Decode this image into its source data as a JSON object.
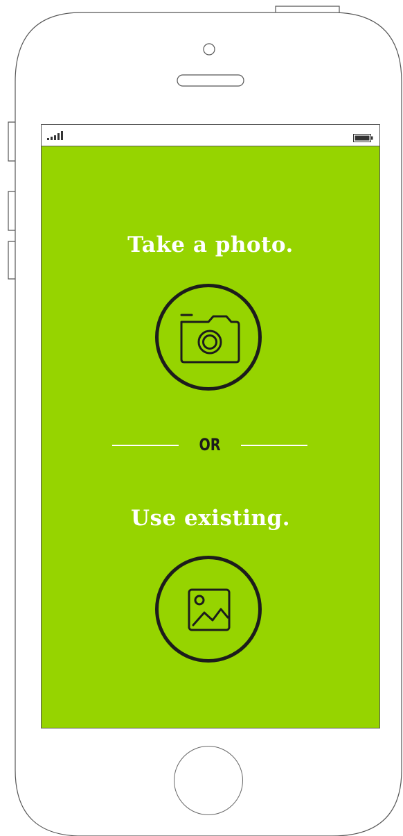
{
  "status_bar": {
    "signal_icon": "signal-bars-icon",
    "battery_icon": "battery-icon"
  },
  "screen": {
    "background_color": "#96d400",
    "take_photo": {
      "label": "Take a photo.",
      "icon": "camera-icon"
    },
    "separator": {
      "label": "OR"
    },
    "use_existing": {
      "label": "Use existing.",
      "icon": "image-icon"
    }
  },
  "colors": {
    "accent": "#96d400",
    "text": "#ffffff",
    "icon_stroke": "#1c1c1c"
  }
}
